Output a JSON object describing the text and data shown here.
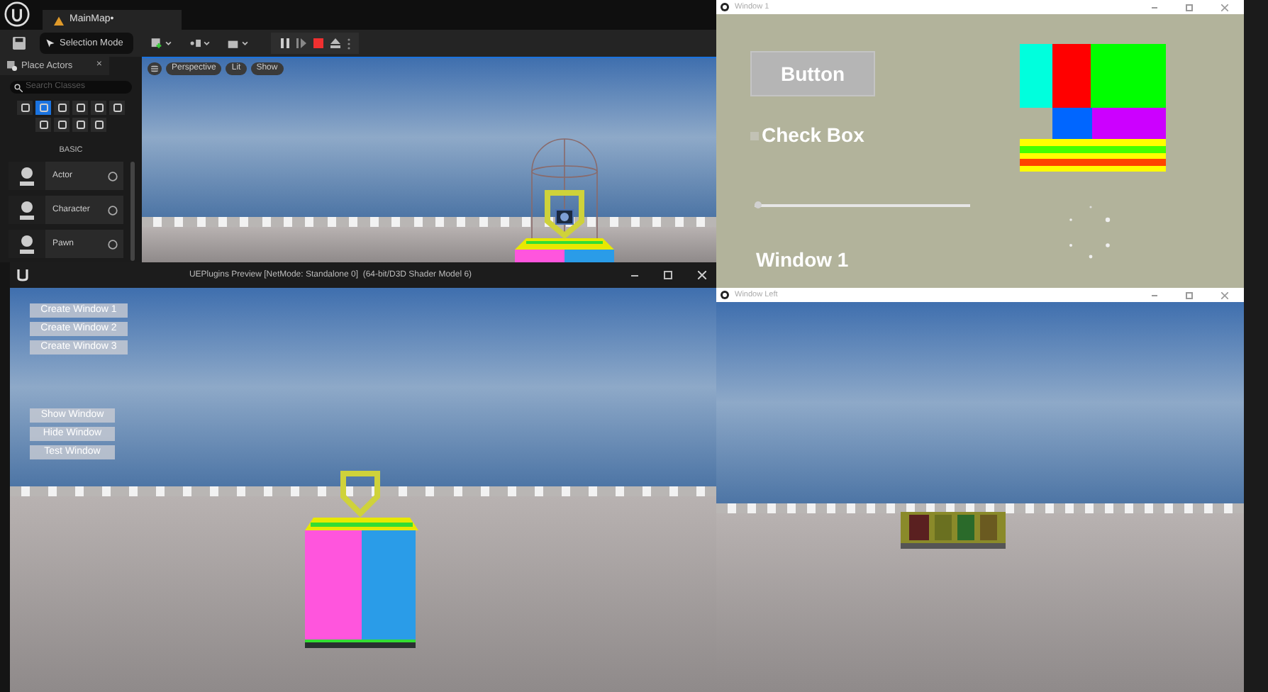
{
  "editor": {
    "tab": "MainMap•",
    "mode_dropdown": "Selection Mode",
    "place_actors": {
      "title": "Place Actors",
      "close": "×",
      "search": {
        "placeholder": "Search Classes"
      },
      "categories": [
        {
          "selected": false
        },
        {
          "selected": true
        },
        {
          "selected": false
        },
        {
          "selected": false
        },
        {
          "selected": false
        },
        {
          "selected": false
        },
        {
          "selected": false
        },
        {
          "selected": false
        },
        {
          "selected": false
        },
        {
          "selected": false
        }
      ],
      "category_label": "BASIC",
      "items": [
        {
          "label": "Actor"
        },
        {
          "label": "Character"
        },
        {
          "label": "Pawn"
        }
      ]
    },
    "viewport": {
      "buttons": [
        "Perspective",
        "Lit",
        "Show"
      ]
    }
  },
  "window_1": {
    "title": "Window 1",
    "button": "Button",
    "checkbox": {
      "label": "Check Box",
      "checked": false
    },
    "slider": {
      "level": 0
    },
    "heading": "Window 1"
  },
  "preview": {
    "title": "UEPlugins Preview [NetMode: Standalone 0]  (64-bit/D3D Shader Model 6)",
    "buttons_top": [
      "Create Window 1",
      "Create Window 2",
      "Create Window 3"
    ],
    "buttons_bottom": [
      "Show Window",
      "Hide Window",
      "Test Window"
    ]
  },
  "window_left": {
    "title": "Window Left"
  }
}
